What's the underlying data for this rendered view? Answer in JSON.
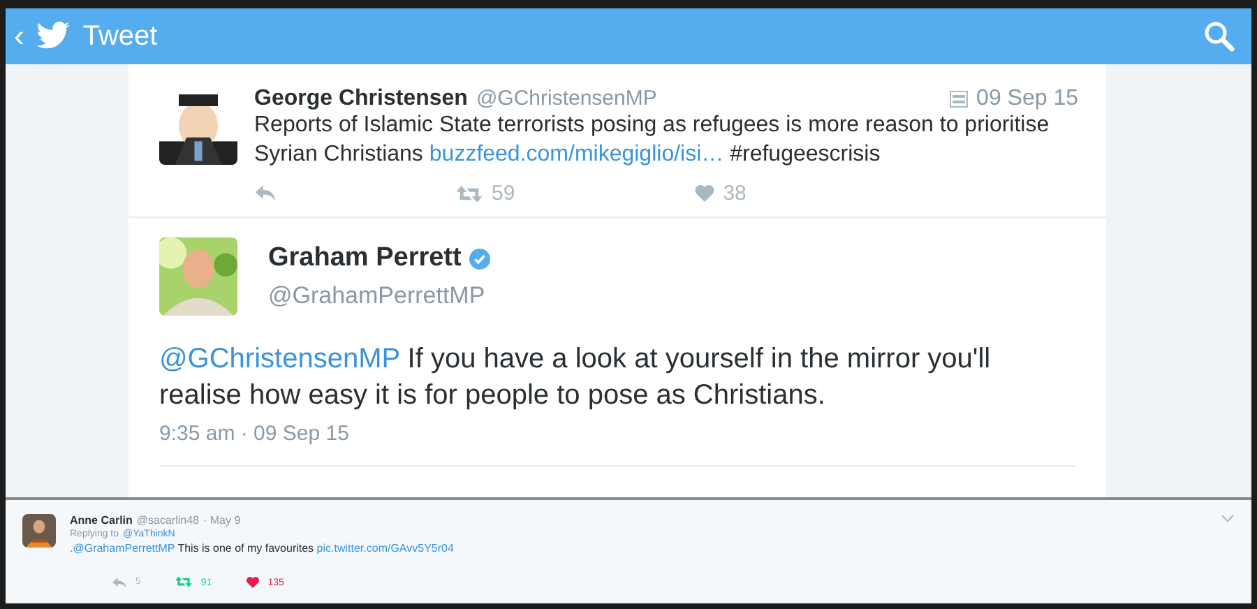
{
  "header": {
    "back": "‹",
    "title": "Tweet"
  },
  "quoted_tweet": {
    "name": "George Christensen",
    "handle": "@GChristensenMP",
    "date": "09 Sep 15",
    "text": "Reports of Islamic State terrorists posing as refugees is more reason to prioritise Syrian Christians",
    "link": "buzzfeed.com/mikegiglio/isi…",
    "hashtag": "#refugeescrisis",
    "retweets": "59",
    "likes": "38",
    "retweeted": false,
    "liked": false
  },
  "main_tweet": {
    "name": "Graham Perrett",
    "verified": true,
    "handle": "@GrahamPerrettMP",
    "mention": "@GChristensenMP",
    "text": "If you have a look at yourself in the mirror you'll realise how easy it is for people to pose as Christians.",
    "time": "9:35 am · 09 Sep 15"
  },
  "reply_tweet": {
    "name": "Anne Carlin",
    "handle": "@sacarlin48",
    "date": "· May 9",
    "replying_label": "Replying to",
    "replying_to": "@YaThinkN",
    "mention": ".@GrahamPerrettMP",
    "text": "This is one of my favourites",
    "link": "pic.twitter.com/GAvv5Y5r04",
    "replies": "5",
    "retweets": "91",
    "likes": "135",
    "retweeted": true,
    "liked": true
  }
}
